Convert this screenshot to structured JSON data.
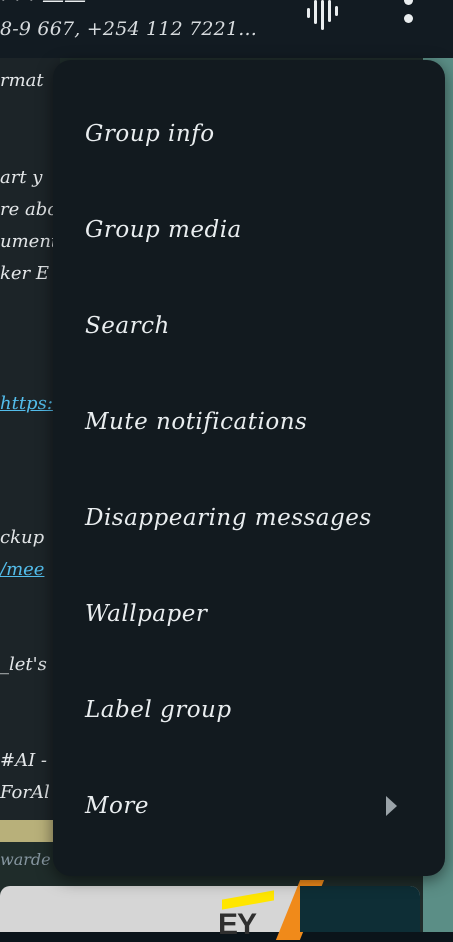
{
  "header": {
    "title_fragment": "· · · ——",
    "subtitle": "8-9 667, +254 112 7221..."
  },
  "chat": {
    "lines": [
      {
        "text": "rmat"
      },
      {
        "text": "art y"
      },
      {
        "text": "re abo"
      },
      {
        "text": "ument"
      },
      {
        "text": "ker E"
      },
      {
        "text": "https:"
      },
      {
        "text": "ckup"
      },
      {
        "text": "/mee"
      },
      {
        "text": "_let's"
      },
      {
        "text": "#AI -"
      },
      {
        "text": "ForAl"
      },
      {
        "text": "warde"
      }
    ],
    "image_brand": "EY"
  },
  "menu": {
    "items": [
      {
        "label": "Group info"
      },
      {
        "label": "Group media"
      },
      {
        "label": "Search"
      },
      {
        "label": "Mute notifications"
      },
      {
        "label": "Disappearing messages"
      },
      {
        "label": "Wallpaper"
      },
      {
        "label": "Label group"
      },
      {
        "label": "More"
      }
    ]
  },
  "colors": {
    "menu_bg": "#121a1f",
    "text": "#e9edef",
    "link": "#53bdeb"
  }
}
